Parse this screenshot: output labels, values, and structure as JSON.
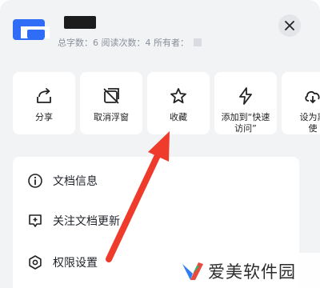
{
  "header": {
    "meta_text": "总字数：6  阅读次数：4  所有者：",
    "close_glyph": "✕"
  },
  "actions": [
    {
      "label": "分享",
      "icon": "share-icon"
    },
    {
      "label": "取消浮窗",
      "icon": "cancel-floating-window-icon"
    },
    {
      "label": "收藏",
      "icon": "star-icon"
    },
    {
      "label": "添加到“快速\n访问”",
      "icon": "lightning-icon"
    },
    {
      "label": "设为离\n使",
      "icon": "offline-icon"
    }
  ],
  "list": [
    {
      "label": "文档信息",
      "icon": "info-icon"
    },
    {
      "label": "关注文档更新",
      "icon": "follow-update-icon"
    },
    {
      "label": "权限设置",
      "icon": "settings-gear-icon"
    }
  ],
  "watermark": {
    "text": "爱美软件园",
    "colors": [
      "#2f7ef0",
      "#e84a3c",
      "#2bb673"
    ]
  },
  "colors": {
    "sheet_bg": "#f2f3f5",
    "brand": "#2f6df6",
    "arrow": "#ee3b2b"
  }
}
